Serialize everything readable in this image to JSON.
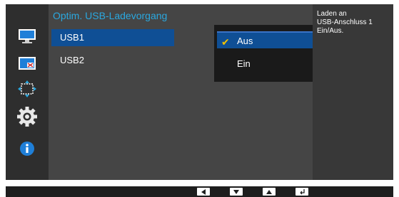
{
  "menu": {
    "title": "Optim. USB-Ladevorgang",
    "items": [
      {
        "label": "USB1",
        "selected": true
      },
      {
        "label": "USB2",
        "selected": false
      }
    ]
  },
  "submenu": {
    "options": [
      {
        "label": "Aus",
        "checked": true
      },
      {
        "label": "Ein",
        "checked": false
      }
    ]
  },
  "help": {
    "lines": [
      "Laden an",
      "USB-Anschluss 1",
      "Ein/Aus."
    ]
  },
  "sidebar": {
    "icons": [
      "monitor-picture-icon",
      "picture-in-picture-icon",
      "screen-size-arrows-icon",
      "settings-gear-icon",
      "information-icon"
    ]
  },
  "keys": [
    "left-arrow-key-icon",
    "down-arrow-key-icon",
    "up-arrow-key-icon",
    "enter-key-icon"
  ],
  "colors": {
    "accent_title": "#2aa8e0",
    "highlight": "#0f4f95",
    "check": "#f2c200"
  }
}
